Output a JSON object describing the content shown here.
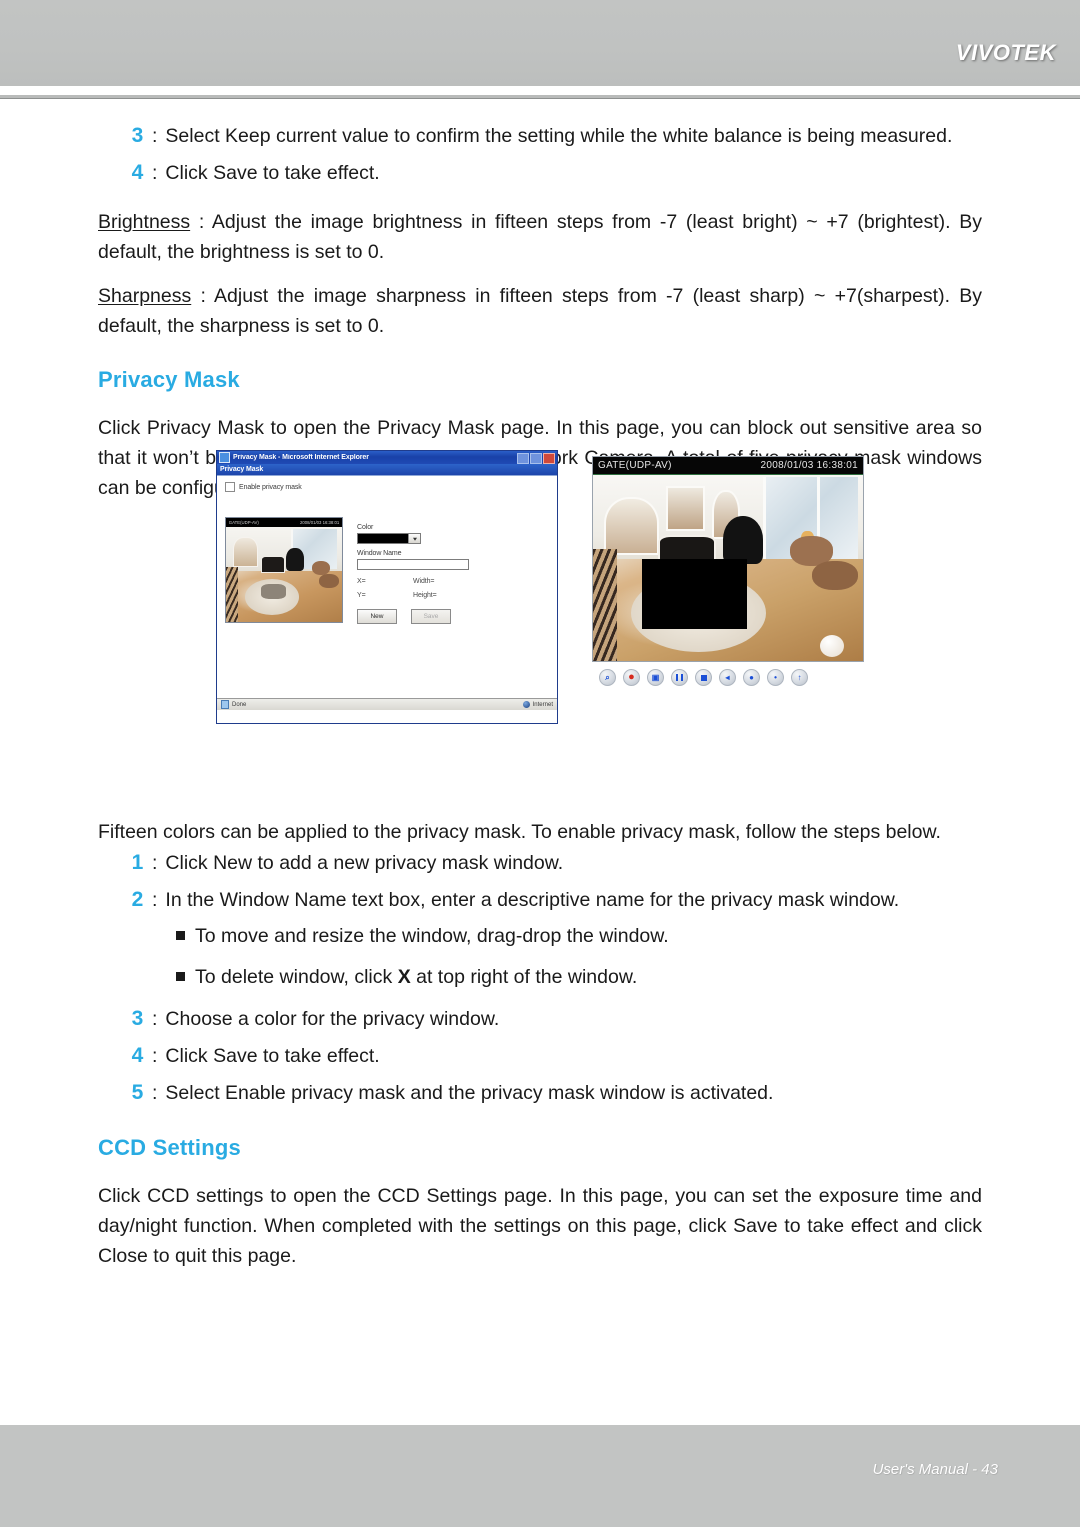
{
  "header": {
    "brand": "VIVOTEK"
  },
  "footer": {
    "page_label": "User's Manual - 43"
  },
  "top_steps": [
    {
      "num": "3",
      "colon": ":",
      "text": "Select Keep current value to confirm the setting while the white balance is being measured."
    },
    {
      "num": "4",
      "colon": ":",
      "text": "Click Save to take effect."
    }
  ],
  "definitions": [
    {
      "term": "Brightness",
      "separator": " : ",
      "text": "Adjust the image brightness in fifteen steps from -7 (least bright) ~ +7 (brightest). By default, the brightness is set to 0."
    },
    {
      "term": "Sharpness",
      "separator": " : ",
      "text": "Adjust the image sharpness in fifteen steps from -7 (least sharp) ~ +7(sharpest). By default, the sharpness is set to 0."
    }
  ],
  "privacy_mask": {
    "heading": "Privacy Mask",
    "intro": "Click Privacy Mask to open the Privacy Mask page. In this page, you can block out sensitive area so that it won’t be seen by anyone accessing the Network Camera. A total of five privacy mask windows can be configured.",
    "post_figure_text": "Fifteen colors can be applied to the privacy mask. To enable privacy mask, follow the steps below.",
    "steps": [
      {
        "num": "1",
        "colon": ":",
        "text": "Click New to add a new privacy mask window."
      },
      {
        "num": "2",
        "colon": ":",
        "text": "In the Window Name text box, enter a descriptive name for the privacy mask window."
      },
      {
        "num": "3",
        "colon": ":",
        "text": "Choose a color for the privacy window."
      },
      {
        "num": "4",
        "colon": ":",
        "text": "Click Save to take effect."
      },
      {
        "num": "5",
        "colon": ":",
        "text": "Select Enable privacy mask and the privacy mask window is activated."
      }
    ],
    "bullets": [
      {
        "pre": "To move and resize the window, drag-drop the window.",
        "bold": "",
        "post": ""
      },
      {
        "pre": "To delete window, click ",
        "bold": "X",
        "post": " at top right of the window."
      }
    ]
  },
  "figure_dialog": {
    "title": "Privacy Mask - Microsoft Internet Explorer",
    "page_bar_title": "Privacy Mask",
    "enable_checkbox_label": "Enable privacy mask",
    "preview": {
      "camera_name": "GATE(UDP-AV)",
      "timestamp": "2008/01/03 16:38:01"
    },
    "form": {
      "color_label": "Color",
      "color_value": "Black",
      "window_name_label": "Window Name",
      "window_name_value": "",
      "x_label": "X=",
      "width_label": "Width=",
      "y_label": "Y=",
      "height_label": "Height=",
      "new_button": "New",
      "save_button": "Save"
    },
    "status": {
      "left": "Done",
      "right": "Internet"
    }
  },
  "figure_live": {
    "camera_name": "GATE(UDP-AV)",
    "timestamp": "2008/01/03 16:38:01",
    "controls": [
      {
        "name": "zoom-icon",
        "glyph": "⌕"
      },
      {
        "name": "record-icon",
        "glyph": "●"
      },
      {
        "name": "snapshot-icon",
        "glyph": "▣"
      },
      {
        "name": "pause-icon",
        "glyph": ""
      },
      {
        "name": "stop-icon",
        "glyph": ""
      },
      {
        "name": "volume-icon",
        "glyph": "◂"
      },
      {
        "name": "mute-icon",
        "glyph": "●"
      },
      {
        "name": "microphone-icon",
        "glyph": "•"
      },
      {
        "name": "talk-icon",
        "glyph": "↑"
      }
    ]
  },
  "ccd_settings": {
    "heading": "CCD Settings",
    "text": "Click CCD settings to open the CCD Settings page. In this page, you can set the exposure time and day/night function. When completed with the settings on this page, click Save to take effect and click Close to quit this page."
  },
  "colors": {
    "accent_blue": "#29ABE2",
    "header_gray": "#c2c4c3",
    "mask_black": "#000000"
  }
}
